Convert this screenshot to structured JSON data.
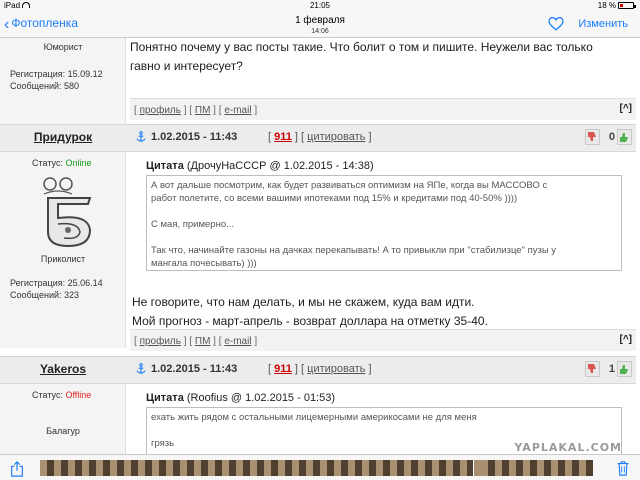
{
  "status_bar": {
    "device": "iPad",
    "time": "21:05",
    "battery": "18 %"
  },
  "nav": {
    "back_label": "Фотопленка",
    "title": "1 февраля",
    "subtitle": "14:06",
    "edit_label": "Изменить"
  },
  "post0": {
    "rank": "Юморист",
    "registration": "Регистрация: 15.09.12",
    "messages": "Сообщений: 580",
    "text_line1": "Понятно почему у вас посты такие. Что болит о том и пишите. Неужели вас только",
    "text_line2": "гавно и интересует?",
    "footer": {
      "profile": "профиль",
      "pm": "ПМ",
      "email": "e-mail",
      "up": "[^]"
    }
  },
  "post1": {
    "author": "Придурок",
    "date": "1.02.2015 - 11:43",
    "number": "911",
    "quote_action": "цитировать",
    "votes": "0",
    "status_label": "Статус:",
    "status_value": "Online",
    "rank": "Приколист",
    "registration": "Регистрация: 25.06.14",
    "messages": "Сообщений: 323",
    "quote_label": "Цитата",
    "quote_source": "(ДрочуНаСССР @ 1.02.2015 - 14:38)",
    "quote_lines": [
      "А вот дальше посмотрим, как будет развиваться оптимизм на ЯПе, когда вы МАССОВО с",
      "работ полетите, со всеми вашими ипотеками под 15% и кредитами под 40-50% ))))",
      "",
      "С мая, примерно...",
      "",
      "Так что, начинайте газоны на дачках перекапывать! А то привыкли при \"стабилизце\" пузы у",
      "мангала почесывать) )))"
    ],
    "text_line1": "Не говорите, что нам делать, и мы не скажем, куда вам идти.",
    "text_line2": "Мой прогноз - март-апрель - возврат доллара на отметку 35-40.",
    "footer": {
      "profile": "профиль",
      "pm": "ПМ",
      "email": "e-mail",
      "up": "[^]"
    }
  },
  "post2": {
    "author": "Yakeros",
    "date": "1.02.2015 - 11:43",
    "number": "911",
    "quote_action": "цитировать",
    "votes": "1",
    "status_label": "Статус:",
    "status_value": "Offline",
    "rank": "Балагур",
    "quote_label": "Цитата",
    "quote_source": "(Roofius @ 1.02.2015 - 01:53)",
    "quote_lines": [
      "ехать жить рядом с остальными лицемерными америкосами не для меня",
      "",
      "грязь"
    ]
  },
  "watermark": "YAPLAKAL.COM",
  "colors": {
    "ios_blue": "#1a7cf5",
    "online": "#1a9a1a",
    "offline": "#dd2222",
    "post_link": "#d10000"
  }
}
